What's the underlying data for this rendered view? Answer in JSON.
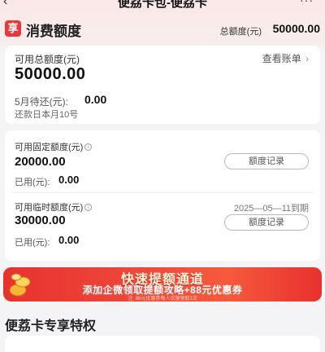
{
  "nav": {
    "title": "便荔卡包-便荔卡",
    "back_glyph": "‹",
    "more_glyph": "···"
  },
  "header": {
    "logo_char": "享",
    "title": "消费额度",
    "total_label": "总额度(元)",
    "total_value": "50000.00"
  },
  "summary": {
    "available_label": "可用总额度(元)",
    "available_value": "50000.00",
    "bill_link": "查看账单",
    "pending_label": "5月待还(元):",
    "pending_value": "0.00",
    "due_text": "还款日本月10号"
  },
  "fixed": {
    "label": "可用固定额度(元)",
    "value": "20000.00",
    "used_label": "已用(元):",
    "used_value": "0.00",
    "record_button": "额度记录"
  },
  "temp": {
    "label": "可用临时额度(元)",
    "value": "30000.00",
    "used_label": "已用(元):",
    "used_value": "0.00",
    "expire": "2025—05—11到期",
    "record_button": "额度记录"
  },
  "banner": {
    "title": "快速提额通道",
    "subtitle": "添加企微领取提额攻略+88元优惠券",
    "note": "注: 88元优惠券每人仅限领取1次"
  },
  "section": {
    "title": "便荔卡专享特权"
  },
  "colors": {
    "accent": "#e8383d",
    "banner_start": "#e8312f",
    "banner_mid": "#f65a3c"
  },
  "icons": {
    "info": "info-icon",
    "chevron": "chevron-right-icon",
    "coins": "coins-icon"
  }
}
